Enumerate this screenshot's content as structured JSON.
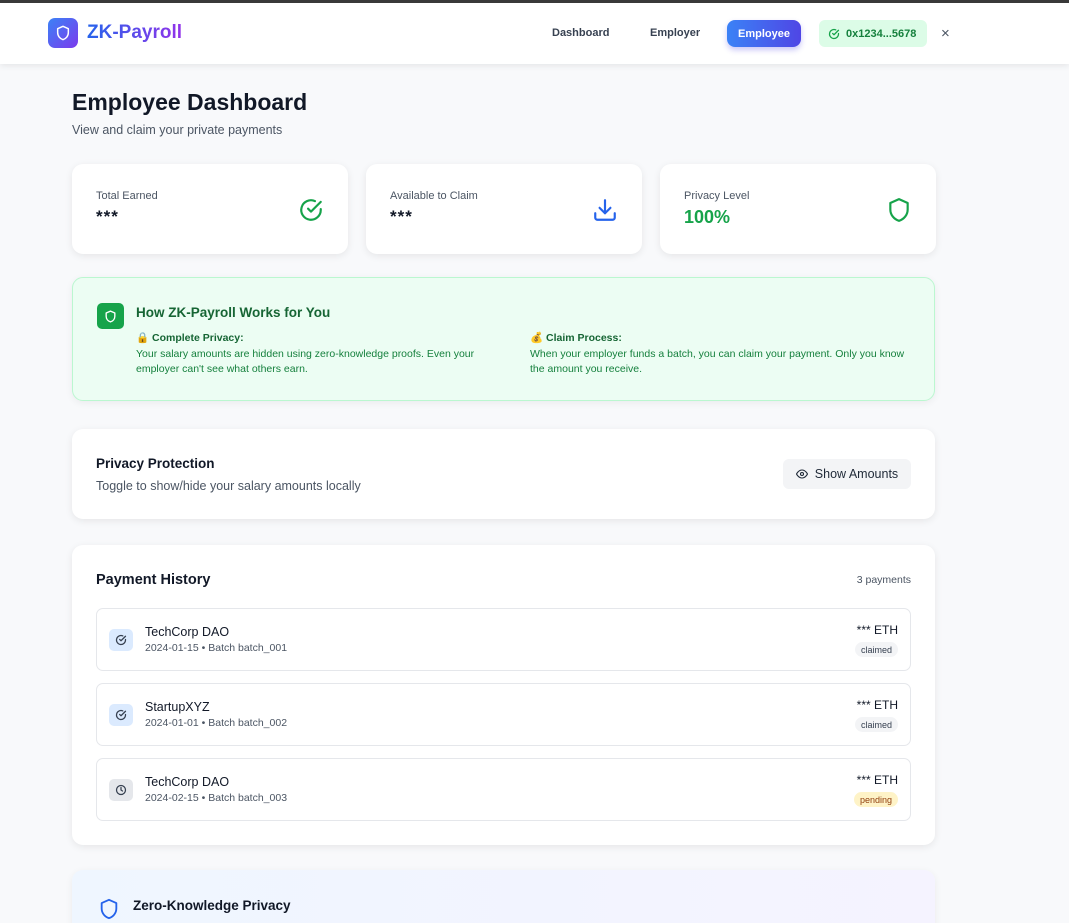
{
  "app": {
    "name": "ZK-Payroll",
    "colors": {
      "brand_start": "#3b82f6",
      "brand_end": "#7c3aed",
      "success": "#16a34a",
      "pending": "#fef3c7"
    }
  },
  "nav": {
    "links": [
      "Dashboard",
      "Employer",
      "Employee"
    ],
    "active": "Employee",
    "wallet_address": "0x1234...5678",
    "close_label": "×"
  },
  "page": {
    "title": "Employee Dashboard",
    "subtitle": "View and claim your private payments"
  },
  "stats": [
    {
      "label": "Total Earned",
      "value": "***",
      "icon": "check-circle-icon"
    },
    {
      "label": "Available to Claim",
      "value": "***",
      "icon": "download-icon"
    },
    {
      "label": "Privacy Level",
      "value": "100%",
      "icon": "shield-icon"
    }
  ],
  "how_it_works": {
    "title": "How ZK-Payroll Works for You",
    "privacy_title": "🔒 Complete Privacy:",
    "privacy_text": "Your salary amounts are hidden using zero-knowledge proofs. Even your employer can't see what others earn.",
    "claim_title": "💰 Claim Process:",
    "claim_text": "When your employer funds a batch, you can claim your payment. Only you know the amount you receive."
  },
  "privacy_protection": {
    "title": "Privacy Protection",
    "subtitle": "Toggle to show/hide your salary amounts locally",
    "button_label": "Show Amounts"
  },
  "payment_history": {
    "title": "Payment History",
    "count_label": "3 payments",
    "items": [
      {
        "company": "TechCorp DAO",
        "meta": "2024-01-15 • Batch batch_001",
        "amount": "*** ETH",
        "status": "claimed"
      },
      {
        "company": "StartupXYZ",
        "meta": "2024-01-01 • Batch batch_002",
        "amount": "*** ETH",
        "status": "claimed"
      },
      {
        "company": "TechCorp DAO",
        "meta": "2024-02-15 • Batch batch_003",
        "amount": "*** ETH",
        "status": "pending"
      }
    ]
  },
  "zk_privacy": {
    "title": "Zero-Knowledge Privacy"
  }
}
